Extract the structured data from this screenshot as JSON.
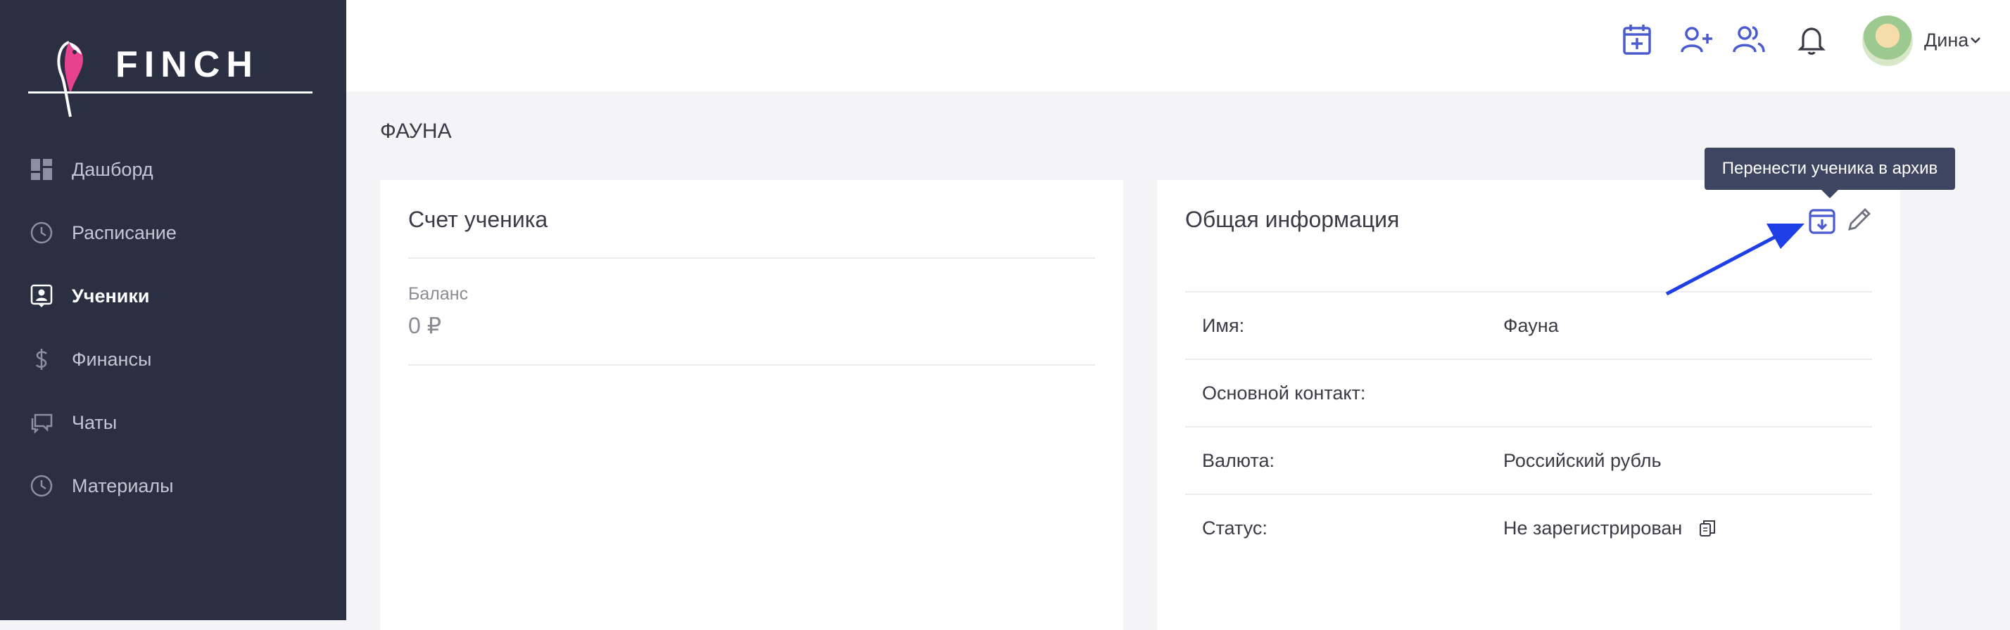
{
  "brand": {
    "name": "FINCH"
  },
  "sidebar": {
    "items": [
      {
        "label": "Дашборд",
        "icon": "dashboard-icon",
        "active": false
      },
      {
        "label": "Расписание",
        "icon": "clock-icon",
        "active": false
      },
      {
        "label": "Ученики",
        "icon": "student-icon",
        "active": true
      },
      {
        "label": "Финансы",
        "icon": "dollar-icon",
        "active": false
      },
      {
        "label": "Чаты",
        "icon": "chat-icon",
        "active": false
      },
      {
        "label": "Материалы",
        "icon": "clock-icon",
        "active": false
      }
    ]
  },
  "topbar": {
    "icons": [
      "calendar-add-icon",
      "add-user-icon",
      "users-icon",
      "bell-icon"
    ],
    "user": {
      "name": "Дина"
    }
  },
  "page": {
    "title": "ФАУНА"
  },
  "account_card": {
    "title": "Счет ученика",
    "balance_label": "Баланс",
    "balance_value": "0 ₽"
  },
  "info_card": {
    "title": "Общая информация",
    "rows": [
      {
        "key": "Имя:",
        "value": "Фауна"
      },
      {
        "key": "Основной контакт:",
        "value": ""
      },
      {
        "key": "Валюта:",
        "value": "Российский рубль"
      },
      {
        "key": "Статус:",
        "value": "Не зарегистрирован"
      }
    ],
    "archive_tooltip": "Перенести ученика в архив"
  },
  "colors": {
    "sidebar_bg": "#2b2f42",
    "accent": "#4a5bd0",
    "annotation_arrow": "#1f3fe6",
    "tooltip_bg": "#3e4560"
  }
}
